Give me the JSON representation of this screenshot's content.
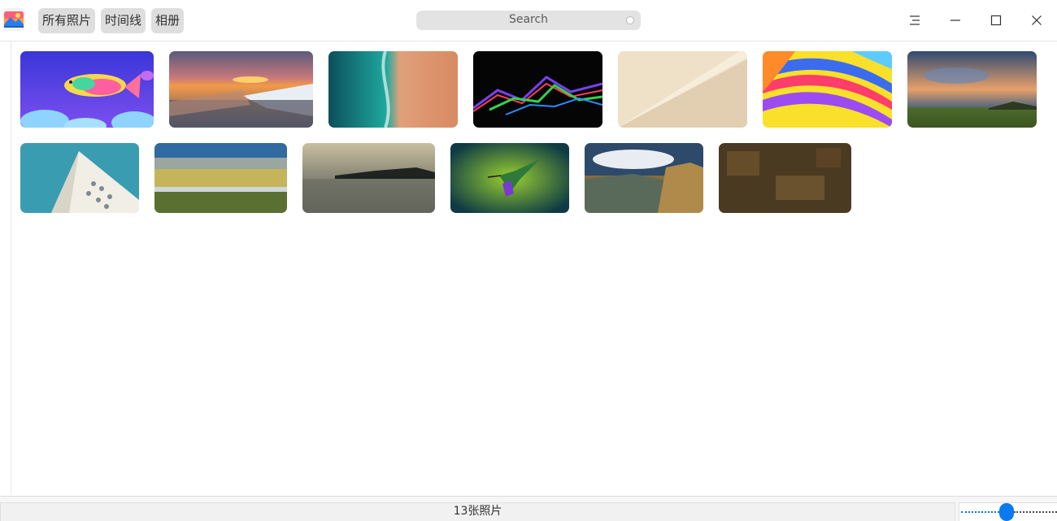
{
  "titlebar": {
    "app_icon": "photos-app-icon",
    "views": [
      {
        "label": "所有照片"
      },
      {
        "label": "时间线"
      },
      {
        "label": "相册"
      }
    ],
    "search": {
      "placeholder": "Search"
    },
    "window_controls": [
      "menu-icon",
      "minimize-icon",
      "maximize-icon",
      "close-icon"
    ]
  },
  "gallery": {
    "photos": [
      {
        "name": "rainbow-whale",
        "row": 1
      },
      {
        "name": "sunset-shore",
        "row": 1
      },
      {
        "name": "aerial-beach",
        "row": 1
      },
      {
        "name": "neon-waves",
        "row": 1
      },
      {
        "name": "sand-dune",
        "row": 1
      },
      {
        "name": "hot-air-balloon",
        "row": 1
      },
      {
        "name": "dusk-meadow",
        "row": 1
      },
      {
        "name": "white-building",
        "row": 2
      },
      {
        "name": "aerial-fields",
        "row": 2
      },
      {
        "name": "misty-lake",
        "row": 2
      },
      {
        "name": "hummingbird",
        "row": 2
      },
      {
        "name": "mountain-valley",
        "row": 2
      },
      {
        "name": "autumn-forest",
        "row": 2
      }
    ]
  },
  "statusbar": {
    "count_text": "13张照片",
    "zoom_level": 0.48
  },
  "colors": {
    "accent": "#0a7af0",
    "button_bg": "#dedede"
  }
}
